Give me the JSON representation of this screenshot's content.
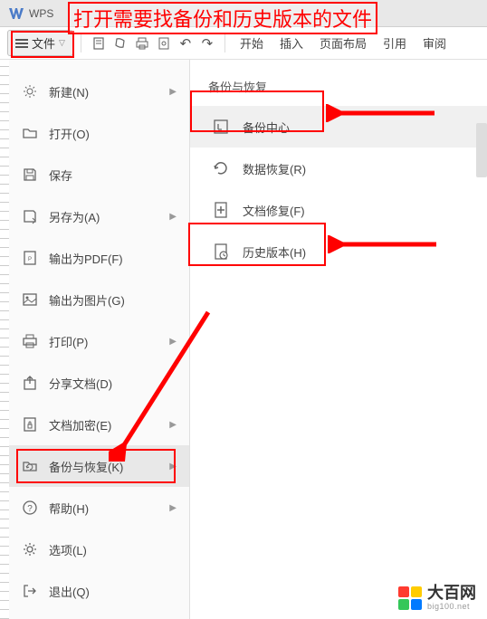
{
  "titlebar": {
    "app_name": "WPS"
  },
  "annotation": {
    "text": "打开需要找备份和历史版本的文件"
  },
  "toolbar": {
    "file_label": "文件",
    "tabs": [
      "开始",
      "插入",
      "页面布局",
      "引用",
      "审阅"
    ]
  },
  "left_menu": [
    {
      "icon": "new",
      "label": "新建(N)",
      "arrow": true
    },
    {
      "icon": "open",
      "label": "打开(O)",
      "arrow": false
    },
    {
      "icon": "save",
      "label": "保存",
      "arrow": false
    },
    {
      "icon": "saveas",
      "label": "另存为(A)",
      "arrow": true
    },
    {
      "icon": "pdf",
      "label": "输出为PDF(F)",
      "arrow": false
    },
    {
      "icon": "image",
      "label": "输出为图片(G)",
      "arrow": false
    },
    {
      "icon": "print",
      "label": "打印(P)",
      "arrow": true
    },
    {
      "icon": "share",
      "label": "分享文档(D)",
      "arrow": false
    },
    {
      "icon": "encrypt",
      "label": "文档加密(E)",
      "arrow": true
    },
    {
      "icon": "backup",
      "label": "备份与恢复(K)",
      "arrow": true,
      "selected": true
    },
    {
      "icon": "help",
      "label": "帮助(H)",
      "arrow": true
    },
    {
      "icon": "options",
      "label": "选项(L)",
      "arrow": false
    },
    {
      "icon": "exit",
      "label": "退出(Q)",
      "arrow": false
    }
  ],
  "right_panel": {
    "title": "备份与恢复",
    "items": [
      {
        "icon": "backup-center",
        "label": "备份中心",
        "highlighted": true
      },
      {
        "icon": "data-recover",
        "label": "数据恢复(R)",
        "highlighted": false
      },
      {
        "icon": "doc-repair",
        "label": "文档修复(F)",
        "highlighted": false
      },
      {
        "icon": "history",
        "label": "历史版本(H)",
        "highlighted": false
      }
    ]
  },
  "watermark": {
    "cn": "大百网",
    "en": "big100.net"
  }
}
